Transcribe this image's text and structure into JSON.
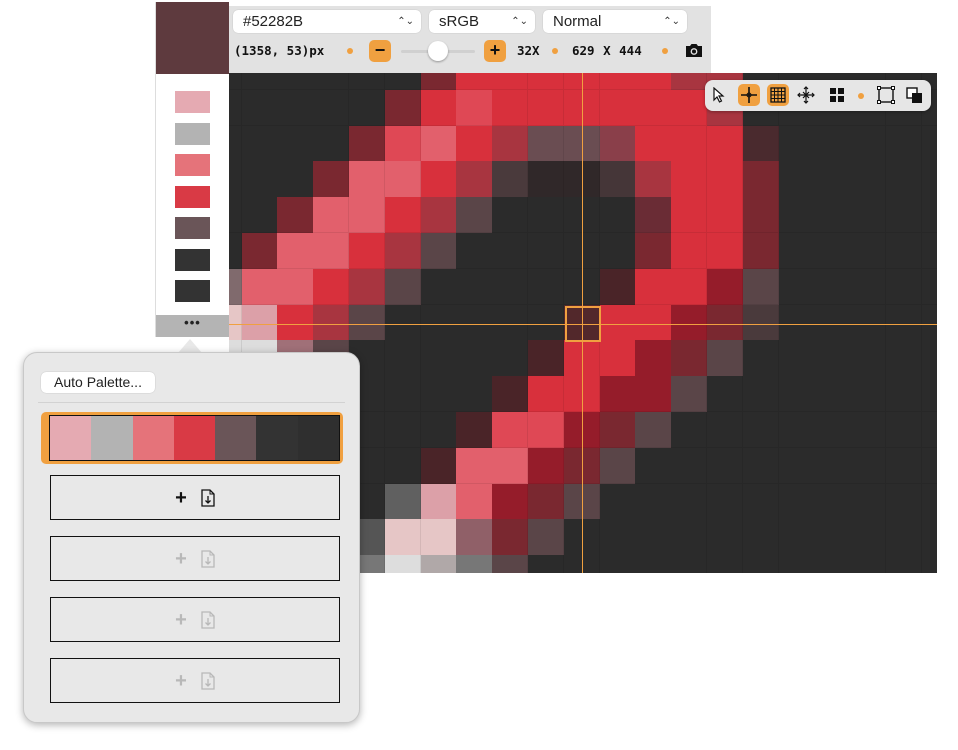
{
  "sidebar": {
    "current_color": "#5E3A3E",
    "swatches": [
      "#E5AAB2",
      "#B3B3B3",
      "#E5737A",
      "#D93A45",
      "#6A5558",
      "#333333",
      "#333333"
    ],
    "more_label": "•••"
  },
  "toolbar": {
    "color_select": "#52282B",
    "colorspace_select": "sRGB",
    "blend_select": "Normal",
    "coordinates": "(1358, 53)px",
    "zoom_minus": "−",
    "zoom_plus": "+",
    "zoom_level": "32X",
    "zoom_slider_fraction": 0.5,
    "dimensions": "629 X 444",
    "accent_color": "#F0A040"
  },
  "floating_toolbar": {
    "tools": [
      {
        "icon": "cursor-icon",
        "active": false
      },
      {
        "icon": "crosshair-icon",
        "active": true
      },
      {
        "icon": "grid-icon",
        "active": true
      },
      {
        "icon": "move-icon",
        "active": false
      },
      {
        "icon": "tiles-icon",
        "active": false
      },
      {
        "icon": "frame-icon",
        "active": false
      },
      {
        "icon": "overlap-icon",
        "active": false
      }
    ]
  },
  "canvas": {
    "selected_color": "#52282B",
    "legend": {
      "K": "#2b2b2b",
      "D": "#7a2830",
      "d": "#4a2428",
      "R": "#d8303c",
      "r": "#df4855",
      "P": "#e2606c",
      "p": "#dca0a8",
      "w": "#e6c6c6",
      "W": "#dddddd",
      "G": "#5a4548",
      "g": "#6a4d52",
      "h": "#453638",
      "j": "#302829",
      "M": "#a83540",
      "m": "#951c2a",
      "n": "#806a6d",
      "o": "#a07078",
      "q": "#906068",
      "s": "#606060",
      "t": "#555555",
      "u": "#777777",
      "v": "#b0a8a8",
      "x": "#8a3f4a",
      "y": "#6a2c35",
      "z": "#4a3a3c",
      "e": "#4a2a2e",
      "S": "#52282B"
    },
    "pixels": [
      "KKKKKKDRRRRRRMMKKKKKK",
      "KKKKKDRrRRRRRRMKKKKKK",
      "KKKKDrPRMggxRRReKKKKK",
      "KKKDPPRMzjjhMRRDKKKKK",
      "KKDPPRMGKKKKyRRDKKKKK",
      "KDPPRMGKKKKKDRRDKKKKK",
      "nPPRMGKKKKKdRRmGKKKKK",
      "wpRMGKKKKKSRRmDzKKKKK",
      "WWoGKKKKKdRRmDGKKKKKK",
      "KKKKKKKKdRRmmGKKKKKKK",
      "KKKKKKKdrrmDGKKKKKKKK",
      "KKKKKKdPPmDGKKKKKKKKK",
      "KKKKKspPmDGKKKKKKKKKK",
      "KKKKtwwqDGKKKKKKKKKKK",
      "KKKKuWvuGKKKKKKKKKKKK"
    ]
  },
  "popover": {
    "auto_palette_label": "Auto Palette...",
    "selected_palette": [
      "#E5AAB2",
      "#B3B3B3",
      "#E5737A",
      "#D93A45",
      "#6A5558",
      "#333333",
      "#2F2F2F"
    ],
    "slots": [
      {
        "enabled": true
      },
      {
        "enabled": false
      },
      {
        "enabled": false
      },
      {
        "enabled": false
      }
    ],
    "add_label": "+"
  }
}
